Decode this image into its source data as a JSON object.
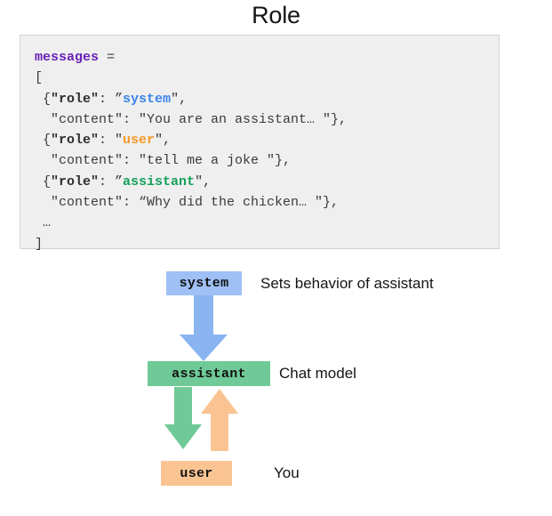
{
  "title": "Role",
  "code": {
    "language": "python",
    "lines": [
      [
        {
          "t": "messages",
          "c": "var"
        },
        {
          "t": " =",
          "c": "plain"
        }
      ],
      [
        {
          "t": "[",
          "c": "plain"
        }
      ],
      [
        {
          "t": " {",
          "c": "plain"
        },
        {
          "t": "\"role\"",
          "c": "key"
        },
        {
          "t": ": ”",
          "c": "plain"
        },
        {
          "t": "system",
          "c": "sys"
        },
        {
          "t": "\",",
          "c": "plain"
        }
      ],
      [
        {
          "t": "  \"content\": \"You are an assistant… \"},",
          "c": "plain"
        }
      ],
      [
        {
          "t": " {",
          "c": "plain"
        },
        {
          "t": "\"role\"",
          "c": "key"
        },
        {
          "t": ": \"",
          "c": "plain"
        },
        {
          "t": "user",
          "c": "user"
        },
        {
          "t": "\",",
          "c": "plain"
        }
      ],
      [
        {
          "t": "  \"content\": \"tell me a joke \"},",
          "c": "plain"
        }
      ],
      [
        {
          "t": " {",
          "c": "plain"
        },
        {
          "t": "\"role\"",
          "c": "key"
        },
        {
          "t": ": ”",
          "c": "plain"
        },
        {
          "t": "assistant",
          "c": "asst"
        },
        {
          "t": "\",",
          "c": "plain"
        }
      ],
      [
        {
          "t": "  \"content\": “Why did the chicken… \"},",
          "c": "plain"
        }
      ],
      [
        {
          "t": " …",
          "c": "plain"
        }
      ],
      [
        {
          "t": "]",
          "c": "plain"
        }
      ]
    ]
  },
  "diagram": {
    "nodes": [
      {
        "id": "system",
        "label": "system",
        "description": "Sets behavior of assistant",
        "color": "#9fc0f5"
      },
      {
        "id": "assistant",
        "label": "assistant",
        "description": "Chat model",
        "color": "#6fca97"
      },
      {
        "id": "user",
        "label": "user",
        "description": "You",
        "color": "#fac492"
      }
    ],
    "arrows": [
      {
        "id": "system-to-assistant",
        "from": "system",
        "to": "assistant",
        "direction": "down",
        "color": "#8ab4f0"
      },
      {
        "id": "assistant-to-user",
        "from": "assistant",
        "to": "user",
        "direction": "down",
        "color": "#6fca97"
      },
      {
        "id": "user-to-assistant",
        "from": "user",
        "to": "assistant",
        "direction": "up",
        "color": "#fac492"
      }
    ]
  },
  "colors": {
    "system": "#9fc0f5",
    "assistant": "#6fca97",
    "user": "#fac492",
    "arrow_blue": "#8ab4f0",
    "code_background": "#efefef",
    "code_border": "#d2d2d4",
    "token_variable": "#6821b8",
    "token_key": "#2e2e2e",
    "token_system": "#3c85ec",
    "token_user": "#f49b28",
    "token_assistant": "#14a05a"
  }
}
